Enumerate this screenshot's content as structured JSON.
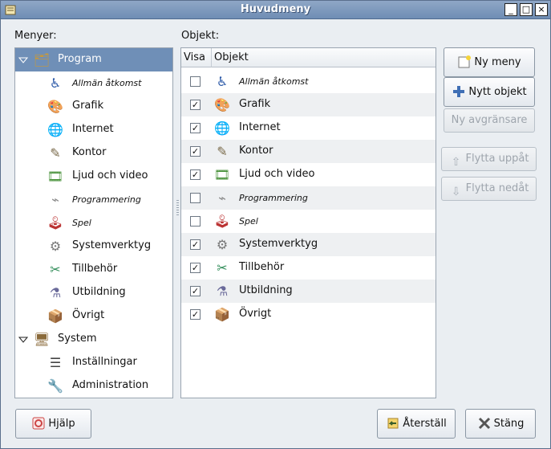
{
  "window": {
    "title": "Huvudmeny",
    "controls": [
      "_",
      "□",
      "×"
    ]
  },
  "menus_label": "Menyer:",
  "objects_label": "Objekt:",
  "columns": {
    "show": "Visa",
    "object": "Objekt"
  },
  "tree": [
    {
      "label": "Program",
      "level": 0,
      "expanded": true,
      "selected": true,
      "italic": false,
      "icon": "applications-icon"
    },
    {
      "label": "Allmän åtkomst",
      "level": 1,
      "italic": true,
      "icon": "accessibility-icon"
    },
    {
      "label": "Grafik",
      "level": 1,
      "italic": false,
      "icon": "graphics-icon"
    },
    {
      "label": "Internet",
      "level": 1,
      "italic": false,
      "icon": "globe-icon"
    },
    {
      "label": "Kontor",
      "level": 1,
      "italic": false,
      "icon": "office-icon"
    },
    {
      "label": "Ljud och video",
      "level": 1,
      "italic": false,
      "icon": "multimedia-icon"
    },
    {
      "label": "Programmering",
      "level": 1,
      "italic": true,
      "icon": "development-icon"
    },
    {
      "label": "Spel",
      "level": 1,
      "italic": true,
      "icon": "games-icon"
    },
    {
      "label": "Systemverktyg",
      "level": 1,
      "italic": false,
      "icon": "system-tools-icon"
    },
    {
      "label": "Tillbehör",
      "level": 1,
      "italic": false,
      "icon": "accessories-icon"
    },
    {
      "label": "Utbildning",
      "level": 1,
      "italic": false,
      "icon": "education-icon"
    },
    {
      "label": "Övrigt",
      "level": 1,
      "italic": false,
      "icon": "other-icon"
    },
    {
      "label": "System",
      "level": 0,
      "expanded": true,
      "selected": false,
      "italic": false,
      "icon": "system-icon"
    },
    {
      "label": "Inställningar",
      "level": 1,
      "italic": false,
      "icon": "preferences-icon"
    },
    {
      "label": "Administration",
      "level": 1,
      "italic": false,
      "icon": "administration-icon"
    }
  ],
  "objects": [
    {
      "label": "Allmän åtkomst",
      "show": false,
      "italic": true,
      "icon": "accessibility-icon"
    },
    {
      "label": "Grafik",
      "show": true,
      "italic": false,
      "icon": "graphics-icon"
    },
    {
      "label": "Internet",
      "show": true,
      "italic": false,
      "icon": "globe-icon"
    },
    {
      "label": "Kontor",
      "show": true,
      "italic": false,
      "icon": "office-icon"
    },
    {
      "label": "Ljud och video",
      "show": true,
      "italic": false,
      "icon": "multimedia-icon"
    },
    {
      "label": "Programmering",
      "show": false,
      "italic": true,
      "icon": "development-icon"
    },
    {
      "label": "Spel",
      "show": false,
      "italic": true,
      "icon": "games-icon"
    },
    {
      "label": "Systemverktyg",
      "show": true,
      "italic": false,
      "icon": "system-tools-icon"
    },
    {
      "label": "Tillbehör",
      "show": true,
      "italic": false,
      "icon": "accessories-icon"
    },
    {
      "label": "Utbildning",
      "show": true,
      "italic": false,
      "icon": "education-icon"
    },
    {
      "label": "Övrigt",
      "show": true,
      "italic": false,
      "icon": "other-icon"
    }
  ],
  "buttons": {
    "new_menu": "Ny meny",
    "new_item": "Nytt objekt",
    "new_separator": "Ny avgränsare",
    "move_up": "Flytta uppåt",
    "move_down": "Flytta nedåt",
    "help": "Hjälp",
    "revert": "Återställ",
    "close": "Stäng"
  },
  "colors": {
    "selection": "#6f8fb7",
    "titlebar": "#7f9abd"
  }
}
